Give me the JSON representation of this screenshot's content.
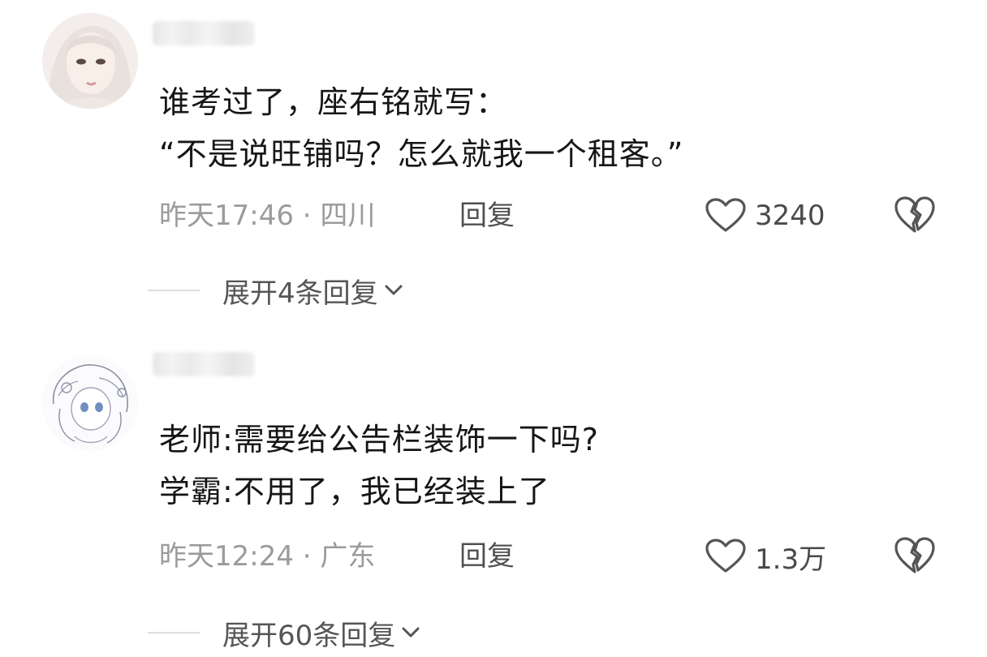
{
  "comments": [
    {
      "username": "",
      "lines": [
        "谁考过了，座右铭就写：",
        "“不是说旺铺吗？怎么就我一个租客。”"
      ],
      "time": "昨天17:46",
      "location": "四川",
      "reply_label": "回复",
      "likes": "3240",
      "expand_label": "展开4条回复"
    },
    {
      "username": "",
      "lines": [
        "老师:需要给公告栏装饰一下吗?",
        "学霸:不用了，我已经装上了"
      ],
      "time": "昨天12:24",
      "location": "广东",
      "reply_label": "回复",
      "likes": "1.3万",
      "expand_label": "展开60条回复"
    }
  ],
  "separator": " · "
}
